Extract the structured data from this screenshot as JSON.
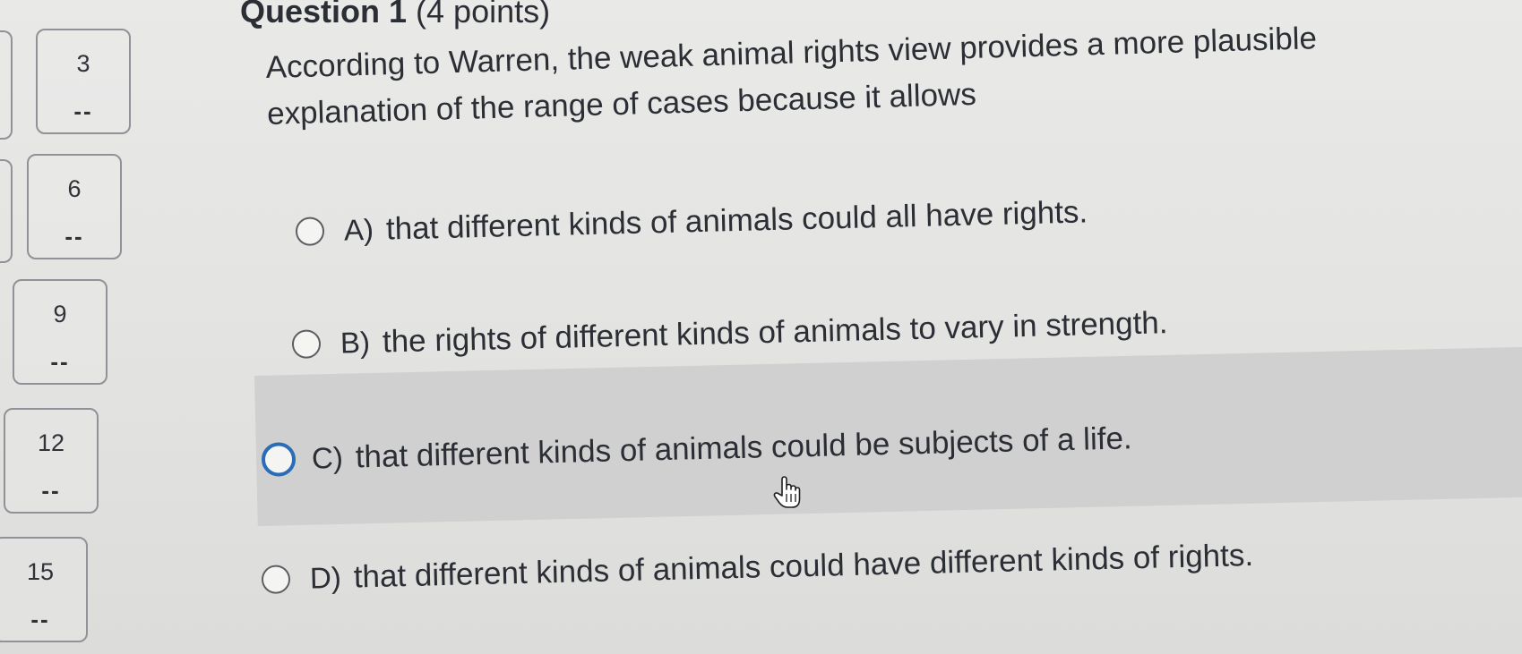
{
  "question": {
    "title_bold": "Question 1",
    "points": "(4 points)",
    "prompt": "According to Warren, the weak animal rights view provides a more plausible explanation of the range of cases because it allows"
  },
  "navigator": [
    {
      "number": "3",
      "status": "--"
    },
    {
      "number": "6",
      "status": "--"
    },
    {
      "number": "9",
      "status": "--"
    },
    {
      "number": "12",
      "status": "--"
    },
    {
      "number": "15",
      "status": "--"
    }
  ],
  "choices": [
    {
      "letter": "A)",
      "text": "that different kinds of animals could all have rights."
    },
    {
      "letter": "B)",
      "text": "the rights of different kinds of animals to vary in strength."
    },
    {
      "letter": "C)",
      "text": "that different kinds of animals could be subjects of a life."
    },
    {
      "letter": "D)",
      "text": "that different kinds of animals could have different kinds of rights."
    }
  ],
  "colors": {
    "focus_ring": "#2b6cb8",
    "hover_band": "#cfd0cf",
    "background": "#e6e6e4"
  },
  "cursor_icon": "hand-pointer-icon"
}
